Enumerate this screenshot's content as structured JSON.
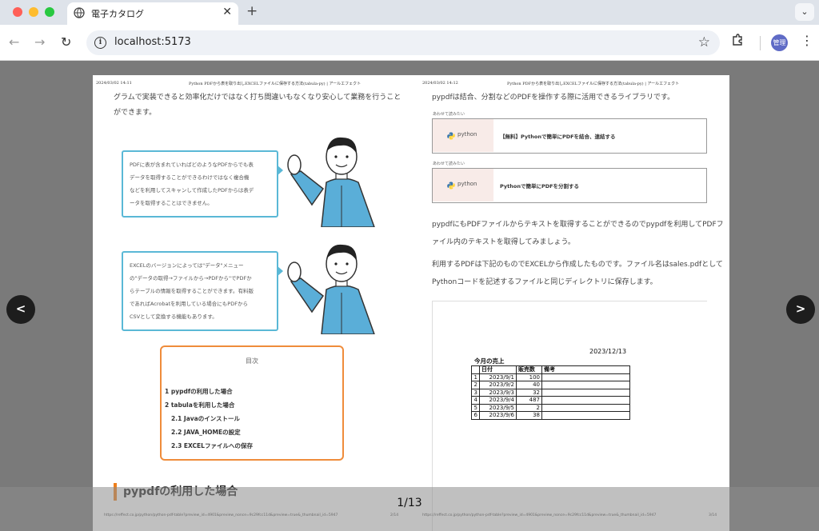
{
  "browser": {
    "tab_title": "電子カタログ",
    "url": "localhost:5173",
    "profile_label": "管理"
  },
  "viewer": {
    "page_indicator": "1/13",
    "prev_label": "<",
    "next_label": ">"
  },
  "left_page": {
    "header_date": "2024/03/02 14:11",
    "header_title": "Python PDFから表を取り出しEXCELファイルに保存する方法(tabula-py) | アールエフェクト",
    "intro_lines": [
      "グラムで実装できると効率化だけではなく打ち間違いもなくなり安心して業務を行うこと",
      "ができます。"
    ],
    "bubble1": [
      "PDFに表が含まれていればどのようなPDFからでも表",
      "データを取得することができるわけではなく複合機",
      "などを利用してスキャンして作成したPDFからは表デ",
      "ータを取得することはできません。"
    ],
    "bubble2": [
      "EXCELのバージョンによっては\"データ\"メニュー",
      "の\"データの取得→ファイルから→PDFから\"でPDFか",
      "らテーブルの情報を取得することができます。有料版",
      "であればAcrobatを利用している場合にもPDFから",
      "CSVとして変換する機能もあります。"
    ],
    "toc": {
      "title": "目次",
      "items": [
        "1 pypdfの利用した場合",
        "2 tabulaを利用した場合",
        "2.1 Javaのインストール",
        "2.2 JAVA_HOMEの設定",
        "2.3 EXCELファイルへの保存"
      ]
    },
    "section_heading": "pypdfの利用した場合",
    "footer_url": "https://reffect.co.jp/python/python-pdf-table?preview_id=4901&preview_nonce=9c29fcc11d&preview=true&_thumbnail_id=5947",
    "footer_page": "2/14"
  },
  "right_page": {
    "header_date": "2024/03/02 14:12",
    "header_title": "Python PDFから表を取り出しEXCELファイルに保存する方法(tabula-py) | アールエフェクト",
    "lead": "pypdfは結合、分割などのPDFを操作する際に活用できるライブラリです。",
    "cards": [
      {
        "label": "あわせて読みたい",
        "thumb": "python",
        "title": "【無料】Pythonで簡単にPDFを結合、連結する"
      },
      {
        "label": "あわせて読みたい",
        "thumb": "python",
        "title": "Pythonで簡単にPDFを分割する"
      }
    ],
    "para1": [
      "pypdfにもPDFファイルからテキストを取得することができるのでpypdfを利用してPDFフ",
      "ァイル内のテキストを取得してみましょう。"
    ],
    "para2": [
      "利用するPDFは下記のものでEXCELから作成したものです。ファイル名はsales.pdfとして",
      "Pythonコードを記述するファイルと同じディレクトリに保存します。"
    ],
    "sheet": {
      "date": "2023/12/13",
      "title": "今月の売上",
      "headers": [
        "日付",
        "販売数",
        "備考"
      ],
      "rows": [
        [
          "1",
          "2023/9/1",
          "100",
          ""
        ],
        [
          "2",
          "2023/9/2",
          "40",
          ""
        ],
        [
          "3",
          "2023/9/3",
          "32",
          ""
        ],
        [
          "4",
          "2023/9/4",
          "487",
          ""
        ],
        [
          "5",
          "2023/9/5",
          "2",
          ""
        ],
        [
          "6",
          "2023/9/6",
          "38",
          ""
        ]
      ]
    },
    "footer_url": "https://reffect.co.jp/python/python-pdf-table?preview_id=4901&preview_nonce=9c29fcc11d&preview=true&_thumbnail_id=5947",
    "footer_page": "3/14"
  }
}
